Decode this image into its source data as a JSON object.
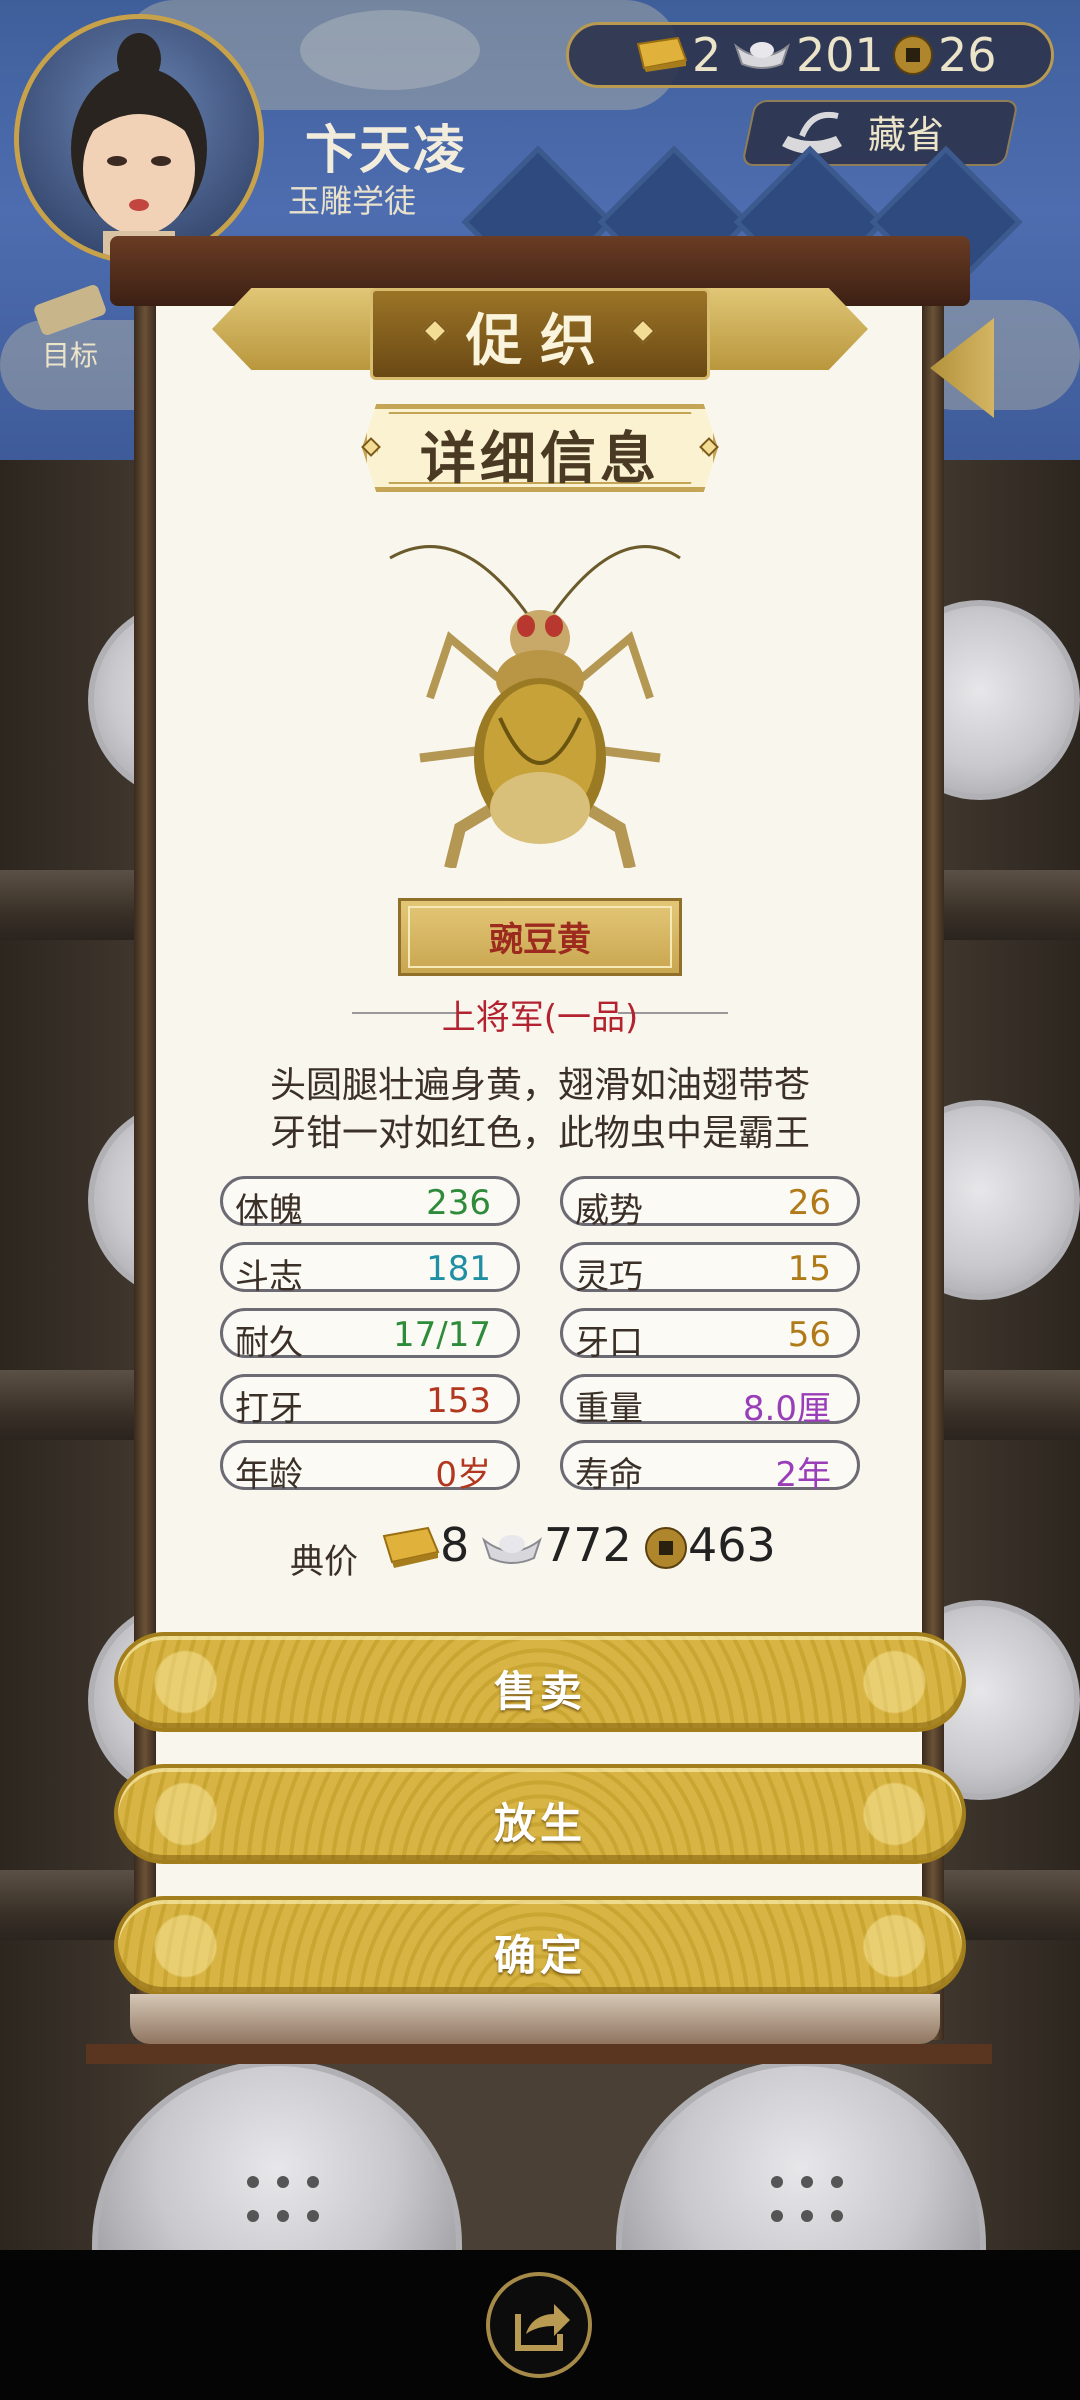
{
  "header": {
    "player_name": "卞天凌",
    "player_title": "玉雕学徒",
    "currency": {
      "gold": "2",
      "silver": "201",
      "coin": "26"
    },
    "collect_label": "藏省",
    "goal_label": "目标"
  },
  "dialog": {
    "title": "促织",
    "section_title": "详细信息",
    "cricket_name": "豌豆黄",
    "rank": "上将军(一品)",
    "poem_line1": "头圆腿壮遍身黄，翅滑如油翅带苍",
    "poem_line2": "牙钳一对如红色，此物虫中是霸王",
    "stats": [
      {
        "label": "体魄",
        "value": "236",
        "color": "#2e8b3a"
      },
      {
        "label": "威势",
        "value": "26",
        "color": "#b07a18"
      },
      {
        "label": "斗志",
        "value": "181",
        "color": "#1f8fa4"
      },
      {
        "label": "灵巧",
        "value": "15",
        "color": "#b07a18"
      },
      {
        "label": "耐久",
        "value": "17/17",
        "color": "#2e8b3a"
      },
      {
        "label": "牙口",
        "value": "56",
        "color": "#b07a18"
      },
      {
        "label": "打牙",
        "value": "153",
        "color": "#b2371f"
      },
      {
        "label": "重量",
        "value": "8.0厘",
        "color": "#9a3db8"
      },
      {
        "label": "年龄",
        "value": "0岁",
        "color": "#b2371f"
      },
      {
        "label": "寿命",
        "value": "2年",
        "color": "#9a3db8"
      }
    ],
    "price_label": "典价",
    "price": {
      "gold": "8",
      "silver": "772",
      "coin": "463"
    },
    "buttons": {
      "sell": "售卖",
      "release": "放生",
      "confirm": "确定"
    }
  },
  "icons": {
    "gold": "gold-ingot-icon",
    "silver": "silver-ingot-icon",
    "coin": "copper-coin-icon",
    "share": "share-icon"
  }
}
